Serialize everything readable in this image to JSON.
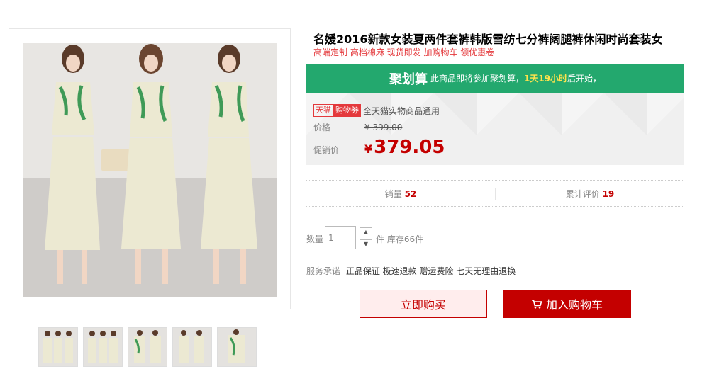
{
  "product": {
    "title": "名媛2016新款女装夏两件套裤韩版雪纺七分裤阔腿裤休闲时尚套装女",
    "subtitle": "高端定制 高档棉麻 现货即发 加购物车 领优惠卷"
  },
  "gallery": {
    "thumbnail_count": 5,
    "fabric_color": "#ece9d2",
    "leaf_color": "#3f9a57"
  },
  "juhuasuan": {
    "brand": "聚划算",
    "text_before": "此商品即将参加聚划算，",
    "highlight": "1天19小时",
    "text_after": "后开始，"
  },
  "coupon": {
    "tmall_tag": "天猫",
    "coupon_tag": "购物券",
    "text": "全天猫实物商品通用"
  },
  "pricing": {
    "original_label": "价格",
    "original_price": "¥ 399.00",
    "promo_label": "促销价",
    "currency": "¥",
    "promo_price": "379.05"
  },
  "stats": {
    "sales_label": "销量",
    "sales_value": "52",
    "reviews_label": "累计评价",
    "reviews_value": "19"
  },
  "quantity": {
    "label": "数量",
    "value": "1",
    "unit_stock": "件 库存66件",
    "up_icon": "arrow-up-icon",
    "down_icon": "arrow-down-icon"
  },
  "service": {
    "label": "服务承诺",
    "items": "正品保证 极速退款 赠运费险 七天无理由退换"
  },
  "actions": {
    "buy_now": "立即购买",
    "add_to_cart": "加入购物车",
    "cart_icon": "cart-icon"
  },
  "colors": {
    "brand_red": "#c40000",
    "juhua_green": "#23a86e",
    "highlight_yellow": "#ffe34c"
  }
}
